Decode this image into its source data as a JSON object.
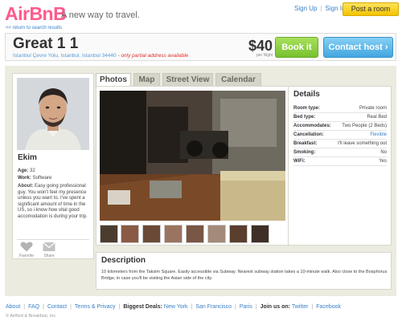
{
  "header": {
    "logo": "AirBnB",
    "tagline": "A new way to travel.",
    "sign_up": "Sign Up",
    "sign_in": "Sign In",
    "post_room": "Post a room",
    "return_link": "<< return to search results"
  },
  "listing": {
    "title": "Great 1 1",
    "address": "Istanbul Çevre Yolu, Istanbul, Istanbul 34440",
    "address_note": "- only partial address available",
    "price": "$40",
    "per_night": "per Night",
    "book_label": "Book it",
    "contact_label": "Contact host",
    "contact_arrow": "›"
  },
  "host": {
    "name": "Ekim",
    "age_label": "Age:",
    "age": "32",
    "work_label": "Work:",
    "work": "Software",
    "about_label": "About:",
    "about": "Easy going professional guy. You won't feel my presence unless you want to. I've spent a significant amount of time in the US, so i know how vital good accomodation is during your trip.",
    "favorite_label": "Favorite",
    "share_label": "Share"
  },
  "tabs": [
    {
      "label": "Photos",
      "active": true
    },
    {
      "label": "Map",
      "active": false
    },
    {
      "label": "Street View",
      "active": false
    },
    {
      "label": "Calendar",
      "active": false
    }
  ],
  "details": {
    "title": "Details",
    "rows": [
      {
        "key": "Room type:",
        "value": "Private room"
      },
      {
        "key": "Bed type:",
        "value": "Real Bed"
      },
      {
        "key": "Accommodates:",
        "value": "Two People (2 Beds)"
      },
      {
        "key": "Cancellation:",
        "value": "Flexible"
      },
      {
        "key": "Breakfast:",
        "value": "I'll leave something out"
      },
      {
        "key": "Smoking:",
        "value": "No"
      },
      {
        "key": "WiFi:",
        "value": "Yes"
      }
    ]
  },
  "description": {
    "title": "Description",
    "text": "10 kilometers from the Taksim Square. Easily accessible via Subway. Nearest subway station takes a 10-minute walk. Also close to the Bosphorus Bridge, in case you'll be visiting the Asian side of the city."
  },
  "footer": {
    "about": "About",
    "faq": "FAQ",
    "contact": "Contact",
    "terms": "Terms & Privacy",
    "biggest_deals": "Biggest Deals:",
    "new_york": "New York",
    "san_francisco": "San Francisco",
    "paris": "Paris",
    "join_us": "Join us on:",
    "twitter": "Twitter",
    "facebook": "Facebook",
    "copyright": "© AirBed & Breakfast, Inc."
  },
  "colors": {
    "brand": "#ff5a8c",
    "book_button": "#78c12e",
    "contact_button": "#43a6df",
    "post_button": "#f3c400",
    "panel_background": "#ecebe0"
  }
}
